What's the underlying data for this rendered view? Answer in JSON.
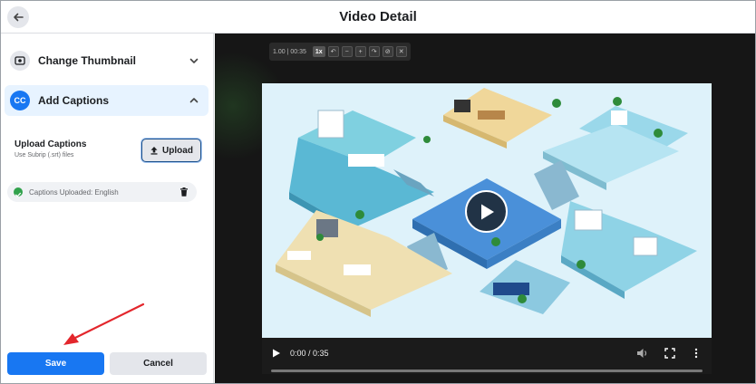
{
  "header": {
    "title": "Video Detail"
  },
  "left_panel": {
    "sections": [
      {
        "label": "Change Thumbnail",
        "icon": "thumbnail-icon",
        "expanded": false
      },
      {
        "label": "Add Captions",
        "icon": "cc-icon",
        "icon_text": "CC",
        "expanded": true
      }
    ],
    "captions": {
      "upload_title": "Upload Captions",
      "upload_subtitle": "Use Subrip (.srt) files",
      "upload_button": "Upload",
      "status_text": "Captions Uploaded: English"
    },
    "buttons": {
      "save": "Save",
      "cancel": "Cancel"
    }
  },
  "player": {
    "toolbar": {
      "time": "1.00 | 00:35",
      "speed": "1x",
      "buttons": [
        "↶",
        "−",
        "+",
        "↷",
        "⊘",
        "✕"
      ]
    },
    "controls": {
      "time": "0:00 / 0:35",
      "progress": 0
    }
  },
  "colors": {
    "accent": "#1877f2",
    "annotation_arrow": "#e3262c",
    "success": "#31a24c"
  }
}
